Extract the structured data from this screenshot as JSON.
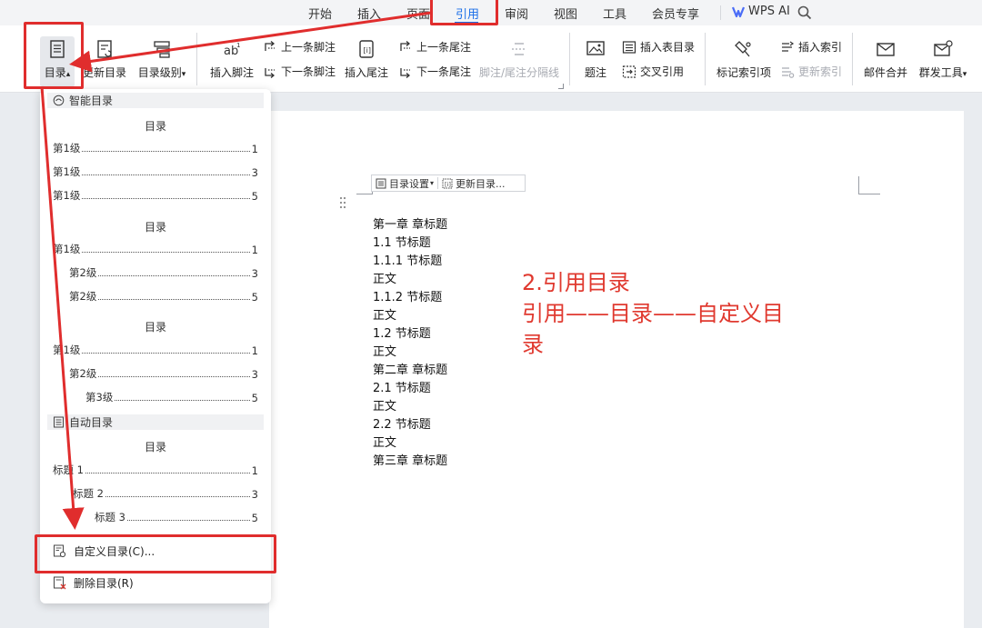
{
  "tabs": [
    {
      "label": "开始",
      "active": false
    },
    {
      "label": "插入",
      "active": false
    },
    {
      "label": "页面",
      "active": false
    },
    {
      "label": "引用",
      "active": true
    },
    {
      "label": "审阅",
      "active": false
    },
    {
      "label": "视图",
      "active": false
    },
    {
      "label": "工具",
      "active": false
    },
    {
      "label": "会员专享",
      "active": false
    },
    {
      "label": "WPS AI",
      "active": false
    }
  ],
  "ribbon": {
    "toc": "目录",
    "toc_arrow": "▴",
    "update_toc": "更新目录",
    "toc_level": "目录级别",
    "dropdown_arrow": "▾",
    "insert_footnote": "插入脚注",
    "prev_footnote": "上一条脚注",
    "next_footnote": "下一条脚注",
    "insert_endnote": "插入尾注",
    "prev_endnote": "上一条尾注",
    "next_endnote": "下一条尾注",
    "note_separator": "脚注/尾注分隔线",
    "caption": "题注",
    "insert_table_toc": "插入表目录",
    "cross_reference": "交叉引用",
    "mark_index": "标记索引项",
    "insert_index": "插入索引",
    "update_index": "更新索引",
    "mail_merge": "邮件合并",
    "bulk_tools": "群发工具"
  },
  "dropdown": {
    "smart_section": "智能目录",
    "auto_section": "自动目录",
    "toc_title": "目录",
    "smart1": [
      {
        "label": "第1级",
        "page": "1"
      },
      {
        "label": "第1级",
        "page": "3"
      },
      {
        "label": "第1级",
        "page": "5"
      }
    ],
    "smart2": [
      {
        "label": "第1级",
        "page": "1"
      },
      {
        "label": "第2级",
        "page": "3"
      },
      {
        "label": "第2级",
        "page": "5"
      }
    ],
    "smart3": [
      {
        "label": "第1级",
        "page": "1"
      },
      {
        "label": "第2级",
        "page": "3"
      },
      {
        "label": "第3级",
        "page": "5"
      }
    ],
    "auto": [
      {
        "label": "标题 1",
        "page": "1"
      },
      {
        "label": "标题 2",
        "page": "3"
      },
      {
        "label": "标题 3",
        "page": "5"
      }
    ],
    "custom_toc": "自定义目录(C)...",
    "delete_toc": "删除目录(R)"
  },
  "doc": {
    "toolbar_settings": "目录设置",
    "toolbar_settings_arrow": "▾",
    "toolbar_update": "更新目录...",
    "lines": [
      "第一章  章标题",
      "1.1  节标题",
      "1.1.1  节标题",
      "正文",
      "1.1.2  节标题",
      "正文",
      "1.2  节标题",
      "正文",
      "第二章  章标题",
      "2.1  节标题",
      "正文",
      "2.2  节标题",
      "正文",
      "第三章  章标题"
    ]
  },
  "annotation": {
    "line1": "2.引用目录",
    "line2": "引用——目录——自定义目",
    "line3": "录"
  },
  "colors": {
    "accent": "#1a6ee8",
    "highlight": "#e02d2d",
    "annotation": "#e0392f"
  }
}
